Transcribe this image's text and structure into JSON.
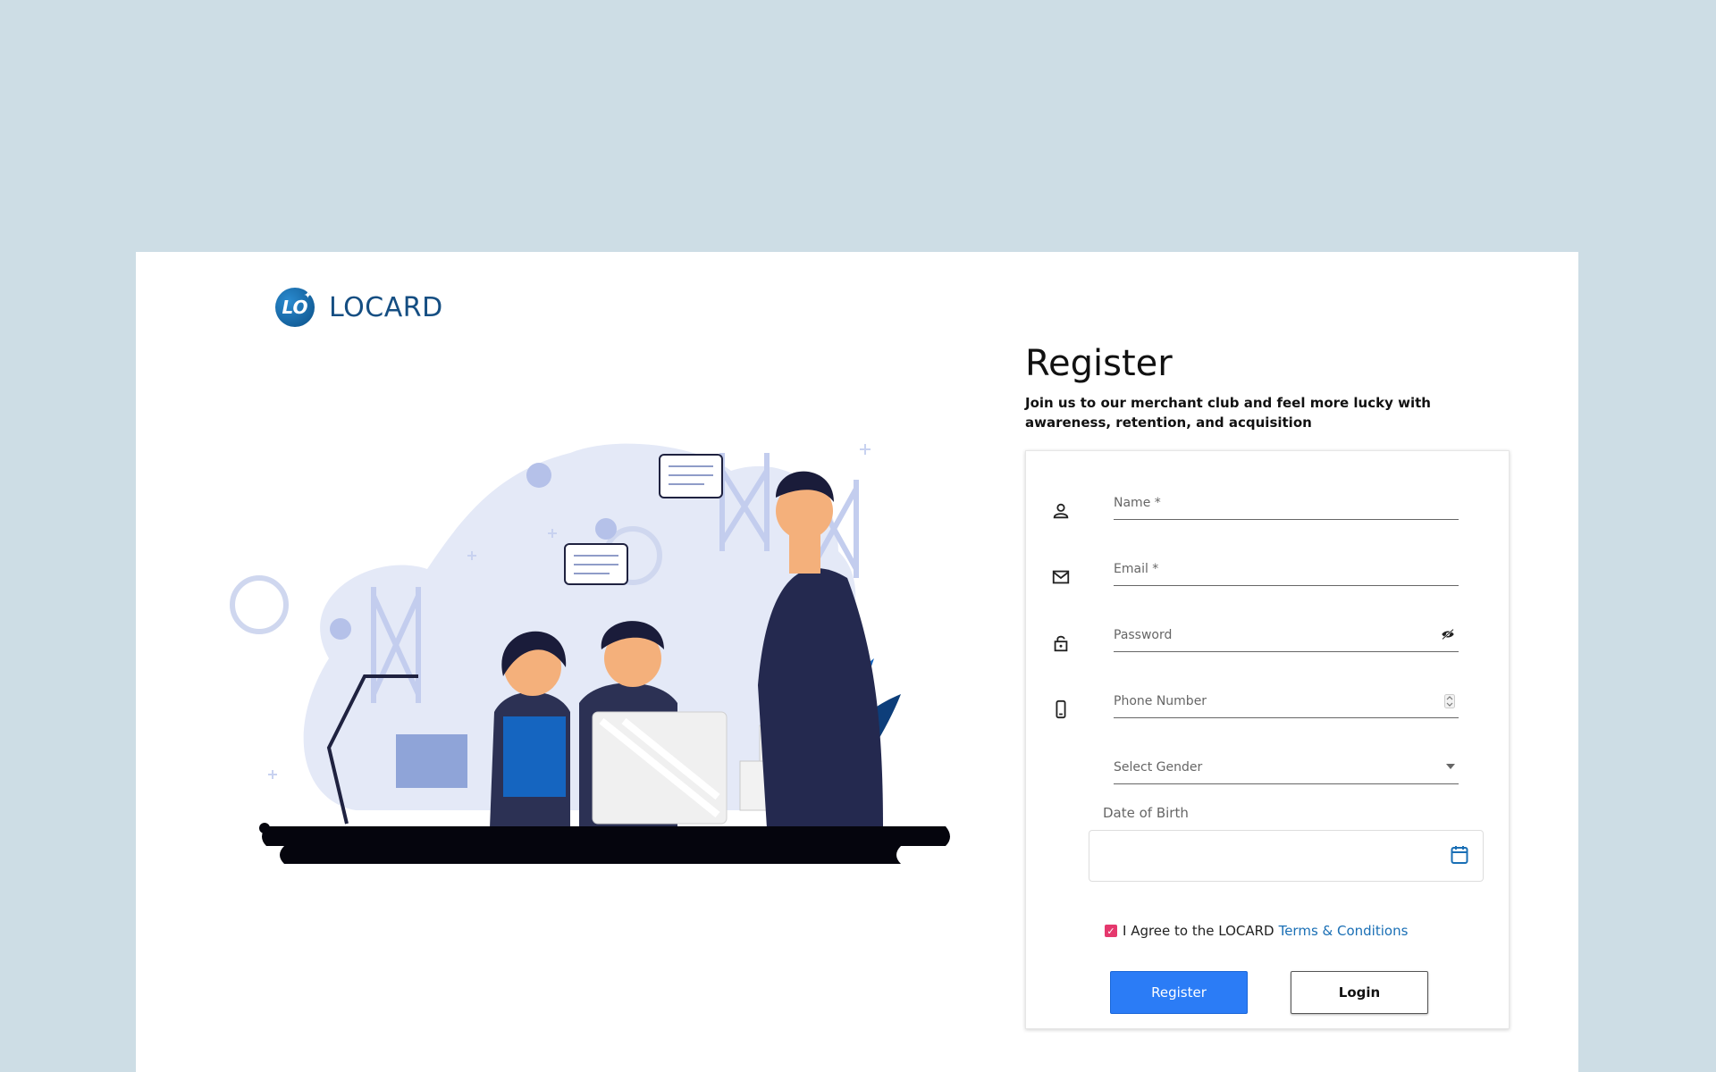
{
  "brand": {
    "name": "LOCARD",
    "badge": "LO"
  },
  "register": {
    "title": "Register",
    "subtitle": "Join us to our merchant club and feel more lucky with awareness, retention, and acquisition"
  },
  "form": {
    "name_placeholder": "Name *",
    "email_placeholder": "Email *",
    "password_placeholder": "Password",
    "phone_placeholder": "Phone Number",
    "gender_placeholder": "Select Gender",
    "dob_label": "Date of Birth",
    "agree_text": "I Agree to the LOCARD",
    "terms_link": "Terms & Conditions",
    "agree_checked": true,
    "register_button": "Register",
    "login_button": "Login"
  },
  "icons": {
    "name": "person-icon",
    "email": "mail-icon",
    "password": "lock-icon",
    "toggle": "eye-off-icon",
    "phone": "phone-icon",
    "dropdown": "caret-down-icon",
    "calendar": "calendar-icon"
  },
  "colors": {
    "background": "#cddde5",
    "brand": "#154e82",
    "primary": "#2b7cf6",
    "checkbox": "#e5386d",
    "link": "#1a6fb5"
  }
}
